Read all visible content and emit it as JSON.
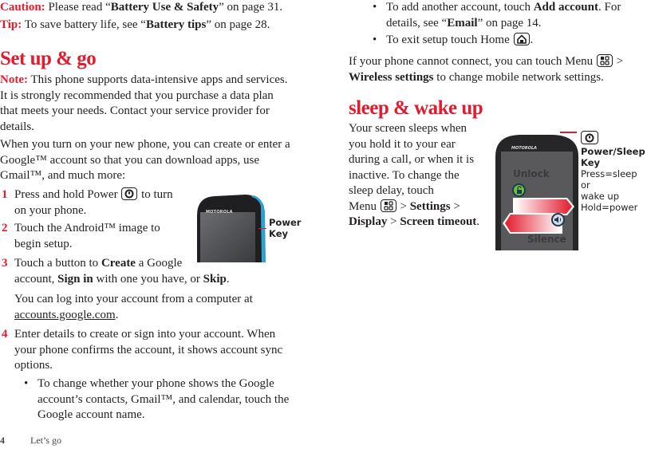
{
  "left_column": {
    "caution": {
      "label": "Caution:",
      "pre": " Please read “",
      "bold": "Battery Use & Safety",
      "post": "” on page 31."
    },
    "tip": {
      "label": "Tip:",
      "pre": " To save battery life, see “",
      "bold": "Battery tips",
      "post": "” on page 28."
    },
    "heading": "Set up & go",
    "note": {
      "label": "Note:",
      "line1": " This phone supports data-intensive apps and services.",
      "line2": "It is strongly recommended that you purchase a data plan",
      "line3": "that meets your needs. Contact your service provider for",
      "line4": "details."
    },
    "intro": {
      "line1": "When you turn on your new phone, you can create or enter a",
      "line2": "Google™ account so that you can download apps, use",
      "line3": "Gmail™, and much more:"
    },
    "steps": [
      {
        "number": "1",
        "line1_pre": "Press and hold Power ",
        "line1_post": " to turn",
        "line2": "on your phone."
      },
      {
        "number": "2",
        "line1": "Touch the Android™ image to",
        "line2": "begin setup."
      },
      {
        "number": "3",
        "line1_pre": "Touch a button to ",
        "bold1": "Create",
        "line1_post": " a Google",
        "line2_pre": "account, ",
        "bold2": "Sign in",
        "line2_mid": " with one you have, or ",
        "bold3": "Skip",
        "line2_post": "."
      },
      {
        "number": "4",
        "line1": "Enter details to create or sign into your account. When",
        "line2": "your phone confirms the account, it shows account sync",
        "line3": "options."
      }
    ],
    "login_note": {
      "line1": "You can log into your account from a computer at",
      "link": "accounts.google.com",
      "post": "."
    },
    "bullet1": {
      "line1": "To change whether your phone shows the Google",
      "line2": "account’s contacts, Gmail™, and calendar, touch the",
      "line3": "Google account name."
    },
    "phone_figure": {
      "brand": "MOTOROLA",
      "callout_line1": "Power",
      "callout_line2": "Key"
    }
  },
  "right_column": {
    "bullet2": {
      "pre": "To add another account, touch ",
      "bold": "Add account",
      "post": ". For",
      "line2_pre": "details, see “",
      "line2_bold": "Email",
      "line2_post": "” on page 14."
    },
    "bullet3": {
      "pre": "To exit setup touch Home ",
      "post": "."
    },
    "connect": {
      "pre": "If your phone cannot connect, you can touch Menu ",
      "post": " >",
      "line2_bold": "Wireless settings",
      "line2_post": " to change mobile network settings."
    },
    "heading": "sleep & wake up",
    "sleep": {
      "line1": "Your screen sleeps when",
      "line2": "you hold it to your ear",
      "line3": "during a call, or when it is",
      "line4": "inactive. To change the",
      "line5": "sleep delay, touch",
      "line6_pre": "Menu ",
      "line6_mid": " > ",
      "line6_bold": "Settings",
      "line6_post": " >",
      "line7_bold1": "Display",
      "line7_mid": " > ",
      "line7_bold2": "Screen timeout",
      "line7_post": "."
    },
    "lock_figure": {
      "brand": "MOTOROLA",
      "unlock_label": "Unlock",
      "silence_label": "Silence",
      "callout_title_line1": "Power/Sleep",
      "callout_title_line2": "Key",
      "callout_line3": "Press=sleep or",
      "callout_line4": "wake up",
      "callout_line5": "Hold=power"
    }
  },
  "footer": {
    "page_number": "4",
    "section": "Let’s go"
  },
  "icons": [
    "power-key-icon",
    "home-key-icon",
    "menu-key-icon",
    "lock-icon",
    "speaker-icon"
  ],
  "colors": {
    "accent_red": "#e31b2e",
    "text": "#231f20",
    "phone_blue": "#2fa8d8"
  }
}
